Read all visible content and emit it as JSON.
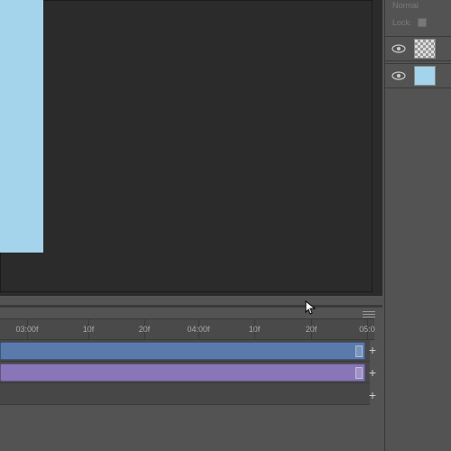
{
  "layers": {
    "blend_mode": "Normal",
    "lock_label": "Lock:",
    "items": [
      {
        "visible": true,
        "thumb": "checker"
      },
      {
        "visible": true,
        "thumb": "blue"
      }
    ]
  },
  "timeline": {
    "ruler": [
      {
        "pos": 30,
        "label": "03:00f",
        "major": true
      },
      {
        "pos": 98,
        "label": "10f",
        "major": false
      },
      {
        "pos": 160,
        "label": "20f",
        "major": false
      },
      {
        "pos": 220,
        "label": "04:00f",
        "major": true
      },
      {
        "pos": 282,
        "label": "10f",
        "major": false
      },
      {
        "pos": 345,
        "label": "20f",
        "major": false
      },
      {
        "pos": 407,
        "label": "05:0",
        "major": true
      }
    ],
    "tracks": [
      {
        "color": "blue"
      },
      {
        "color": "purple"
      },
      {
        "color": "empty"
      }
    ],
    "add_label": "+"
  }
}
